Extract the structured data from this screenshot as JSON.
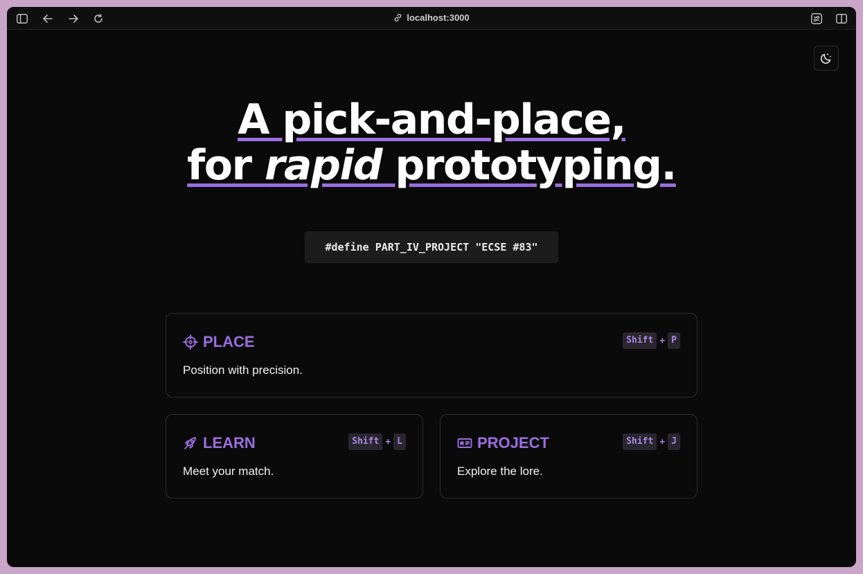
{
  "browser": {
    "url": "localhost:3000"
  },
  "hero": {
    "line1": "A pick-and-place,",
    "line2_pre": "for ",
    "line2_em": "rapid",
    "line2_post": " prototyping."
  },
  "code_snippet": "#define PART_IV_PROJECT \"ECSE #83\"",
  "cards": [
    {
      "title": "PLACE",
      "icon": "crosshair-icon",
      "description": "Position with precision.",
      "shortcut": {
        "mod": "Shift",
        "key": "P"
      }
    },
    {
      "title": "LEARN",
      "icon": "rocket-icon",
      "description": "Meet your match.",
      "shortcut": {
        "mod": "Shift",
        "key": "L"
      }
    },
    {
      "title": "PROJECT",
      "icon": "id-card-icon",
      "description": "Explore the lore.",
      "shortcut": {
        "mod": "Shift",
        "key": "J"
      }
    }
  ],
  "colors": {
    "accent": "#9b6ee0",
    "background": "#0a0a0a",
    "window_frame": "#c9a6c8"
  }
}
